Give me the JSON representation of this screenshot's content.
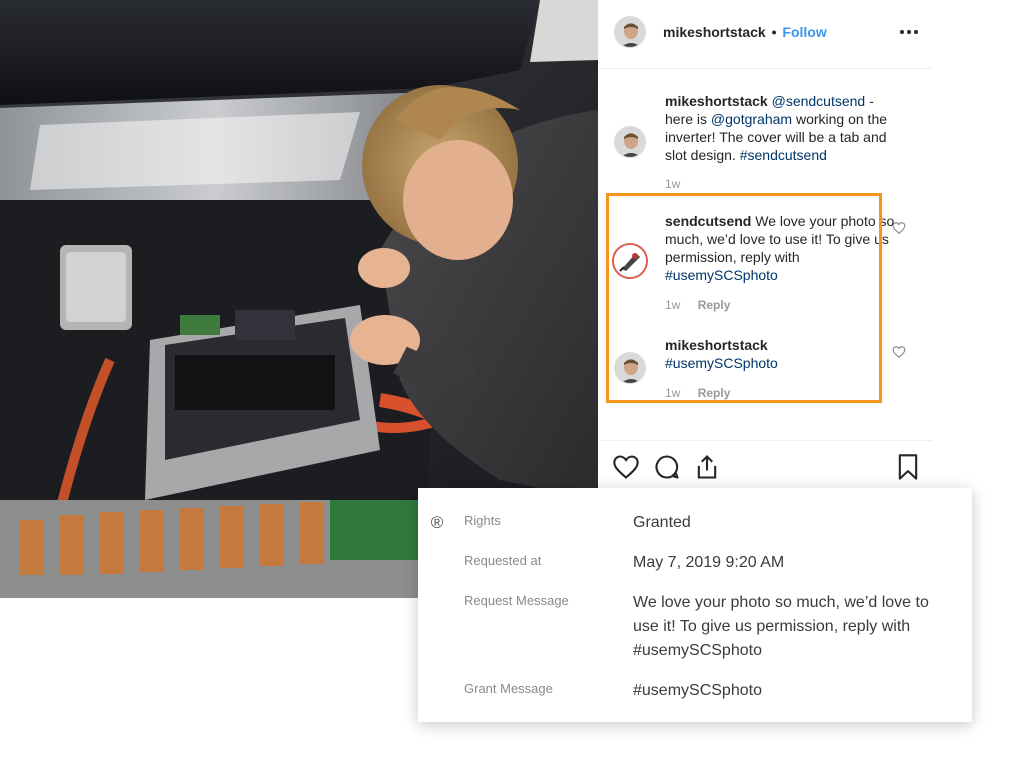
{
  "post": {
    "username": "mikeshortstack",
    "separator": "•",
    "follow_label": "Follow",
    "more_icon": "more-horizontal-icon"
  },
  "caption": {
    "username": "mikeshortstack",
    "mention1": "@sendcutsend",
    "text1": " - here is ",
    "mention2": "@gotgraham",
    "text2": " working on the inverter! The cover will be a tab and slot design. ",
    "hashtag": "#sendcutsend",
    "age": "1w"
  },
  "comments": [
    {
      "username": "sendcutsend",
      "text": " We love your photo so much, we’d love to use it! To give us permission, reply with ",
      "hashtag": "#usemySCSphoto",
      "age": "1w",
      "reply_label": "Reply"
    },
    {
      "username": "mikeshortstack",
      "text": " ",
      "hashtag": "#usemySCSphoto",
      "age": "1w",
      "reply_label": "Reply"
    }
  ],
  "actions": {
    "like_icon": "heart-icon",
    "comment_icon": "comment-icon",
    "share_icon": "share-icon",
    "save_icon": "bookmark-icon"
  },
  "rights_card": {
    "icon": "registered-icon",
    "rows": [
      {
        "label": "Rights",
        "value": "Granted"
      },
      {
        "label": "Requested at",
        "value": "May 7, 2019 9:20 AM"
      },
      {
        "label": "Request Message",
        "value": "We love your photo so much, we’d love to use it! To give us permission, reply with #usemySCSphoto"
      },
      {
        "label": "Grant Message",
        "value": "#usemySCSphoto"
      }
    ]
  },
  "colors": {
    "follow": "#3897f0",
    "link": "#003569",
    "highlight": "#f7941d",
    "muted": "#999999"
  }
}
